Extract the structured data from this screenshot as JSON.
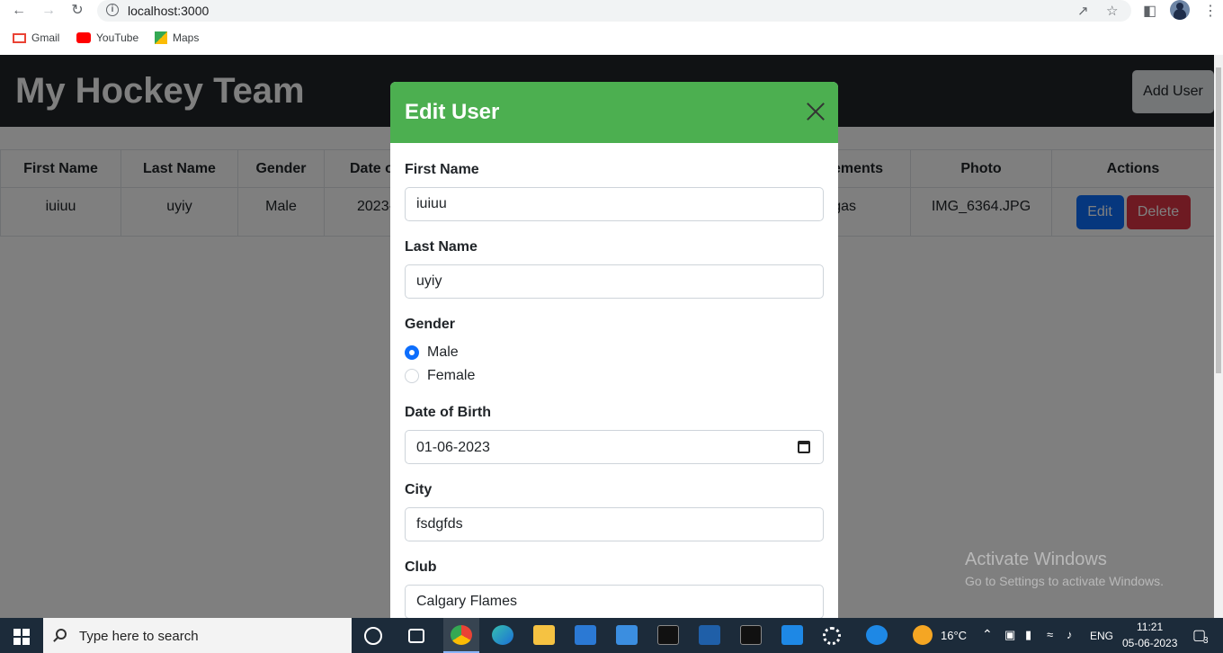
{
  "browser": {
    "url": "localhost:3000",
    "bookmarks": [
      "Gmail",
      "YouTube",
      "Maps"
    ]
  },
  "app": {
    "title": "My Hockey Team",
    "add_user_label": "Add User"
  },
  "table": {
    "headers": [
      "First Name",
      "Last Name",
      "Gender",
      "Date o",
      "ements",
      "Photo",
      "Actions"
    ],
    "row": {
      "first_name": "iuiuu",
      "last_name": "uyiy",
      "gender": "Male",
      "dob": "2023-",
      "achievements": "gas",
      "photo": "IMG_6364.JPG",
      "edit_label": "Edit",
      "delete_label": "Delete"
    }
  },
  "modal": {
    "title": "Edit User",
    "fields": {
      "first_name_label": "First Name",
      "first_name_value": "iuiuu",
      "last_name_label": "Last Name",
      "last_name_value": "uyiy",
      "gender_label": "Gender",
      "gender_options": [
        "Male",
        "Female"
      ],
      "gender_selected": "Male",
      "dob_label": "Date of Birth",
      "dob_value": "01-06-2023",
      "city_label": "City",
      "city_value": "fsdgfds",
      "club_label": "Club",
      "club_value": "Calgary Flames"
    }
  },
  "watermark": {
    "line1": "Activate Windows",
    "line2": "Go to Settings to activate Windows."
  },
  "taskbar": {
    "search_placeholder": "Type here to search",
    "weather": "16°C",
    "language": "ENG",
    "time": "11:21",
    "date": "05-06-2023",
    "notifications": "3"
  }
}
